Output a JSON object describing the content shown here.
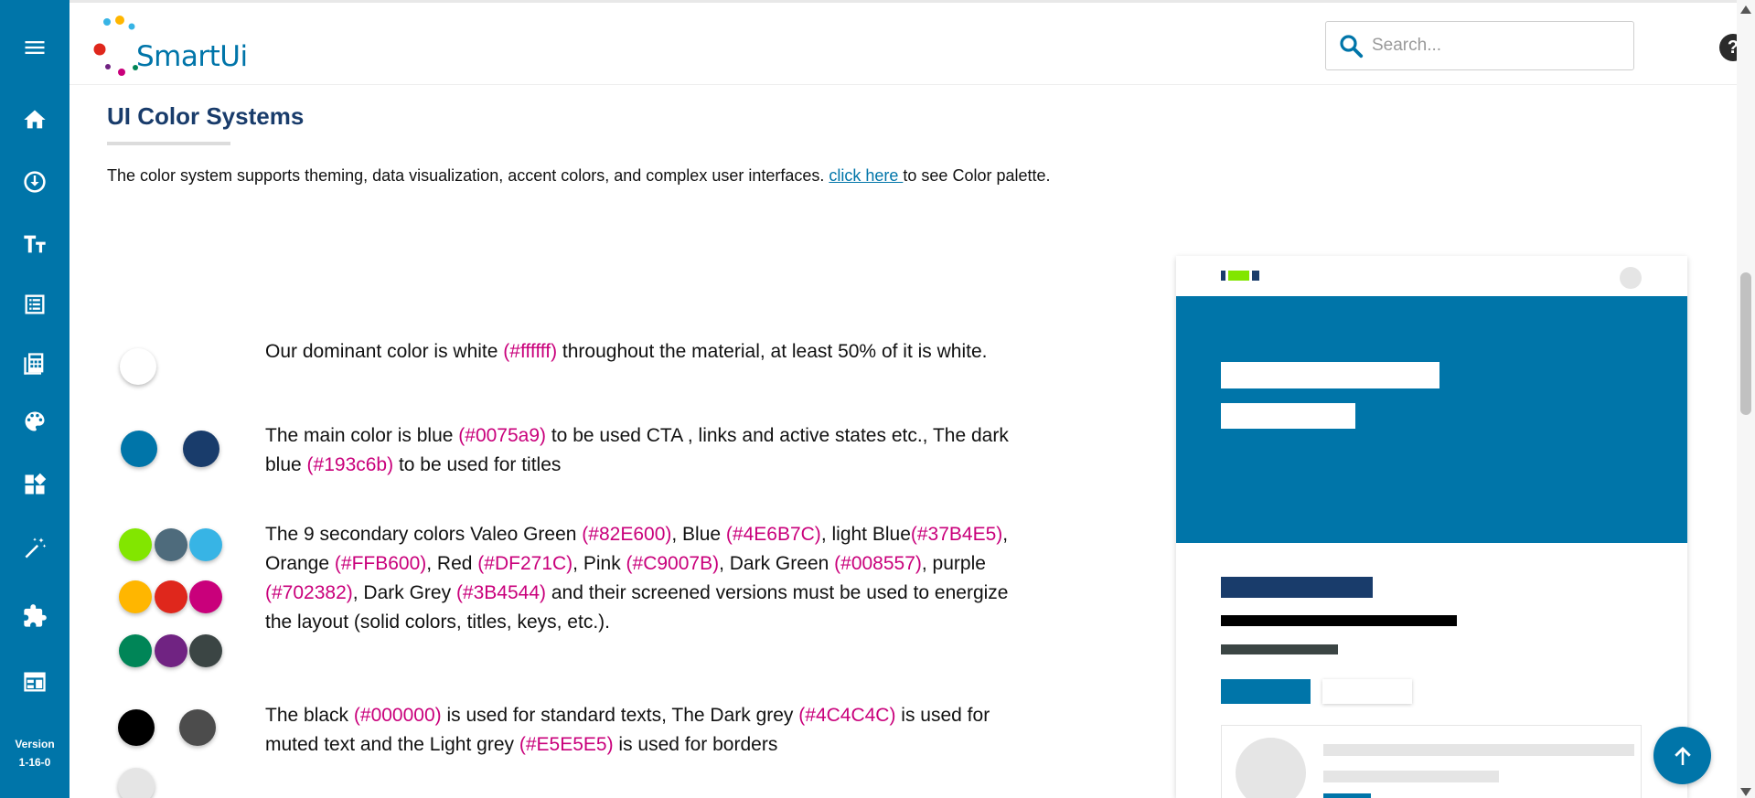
{
  "app": {
    "logo_text": "SmartUi",
    "version_label": "Version",
    "version_number": "1-16-0"
  },
  "sidebar": {
    "items": [
      {
        "icon": "menu-icon"
      },
      {
        "icon": "home-icon"
      },
      {
        "icon": "download-circle-icon"
      },
      {
        "icon": "text-size-icon"
      },
      {
        "icon": "list-icon"
      },
      {
        "icon": "calculator-icon"
      },
      {
        "icon": "palette-icon"
      },
      {
        "icon": "widgets-icon"
      },
      {
        "icon": "magic-wand-icon"
      },
      {
        "icon": "puzzle-icon"
      },
      {
        "icon": "table-layout-icon"
      }
    ]
  },
  "search": {
    "placeholder": "Search..."
  },
  "help": {
    "label": "?"
  },
  "page": {
    "title": "UI Color Systems",
    "intro": "The color system supports theming, data visualization, accent colors, and complex user interfaces. ",
    "intro_link": "click here ",
    "intro_after": "to see Color palette."
  },
  "sections": {
    "white": {
      "t1": "Our dominant color is white ",
      "h1": "(#ffffff)",
      "t2": " throughout the material, at least 50% of it is white."
    },
    "blue": {
      "t1": "The main color is blue ",
      "h1": "(#0075a9)",
      "t2": " to be used CTA , links and active states etc., The dark blue ",
      "h2": "(#193c6b)",
      "t3": " to be used for titles"
    },
    "secondary": {
      "t1": "The 9 secondary colors Valeo Green ",
      "h1": "(#82E600)",
      "t2": ", Blue ",
      "h2": "(#4E6B7C)",
      "t3": ", light Blue",
      "h3": "(#37B4E5)",
      "t4": ", Orange ",
      "h4": "(#FFB600)",
      "t5": ", Red ",
      "h5": "(#DF271C)",
      "t6": ", Pink ",
      "h6": "(#C9007B)",
      "t7": ", Dark Green ",
      "h7": "(#008557)",
      "t8": ", purple ",
      "h8": "(#702382)",
      "t9": ", Dark Grey ",
      "h9": "(#3B4544)",
      "t10": " and their screened versions must be used to energize the layout (solid colors, titles, keys, etc.)."
    },
    "neutral": {
      "t1": "The black ",
      "h1": "(#000000)",
      "t2": " is used for standard texts, The Dark grey ",
      "h2": "(#4C4C4C)",
      "t3": " is used for muted text and the Light grey ",
      "h3": "(#E5E5E5)",
      "t4": " is used for borders"
    }
  },
  "swatches": {
    "white": "#ffffff",
    "blue": "#0075a9",
    "dark_blue": "#193c6b",
    "valeo_green": "#82E600",
    "secondary_blue": "#4E6B7C",
    "light_blue": "#37B4E5",
    "orange": "#FFB600",
    "red": "#DF271C",
    "pink": "#C9007B",
    "dark_green": "#008557",
    "purple": "#702382",
    "dark_grey": "#3B4544",
    "black": "#000000",
    "muted_grey": "#4C4C4C",
    "light_grey": "#E5E5E5"
  },
  "scroll_top": {
    "icon": "arrow-up-icon"
  }
}
